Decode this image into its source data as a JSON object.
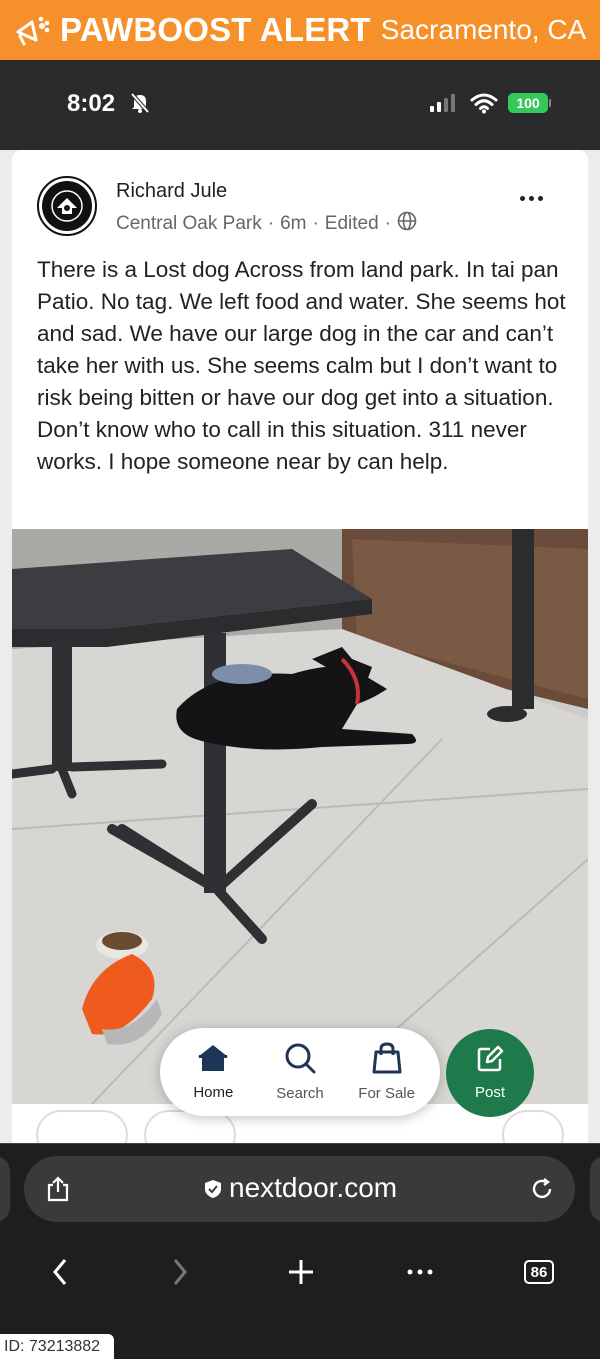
{
  "banner": {
    "brand": "PAWBOOST ALERT",
    "city": "Sacramento, CA",
    "color": "#f5902a"
  },
  "status": {
    "time": "8:02",
    "battery": "100"
  },
  "post": {
    "author": "Richard Jule",
    "location": "Central Oak Park",
    "age": "6m",
    "edited": "Edited",
    "sep": "·",
    "text": "There is a Lost dog Across from land park. In tai pan Patio. No tag. We left food and water. She seems hot and sad. We have our large dog in the car and can’t take her with us. She seems calm but I don’t want to risk being bitten or have our dog get into a situation. Don’t know who to call in this situation. 311 never works. I hope someone near by can help."
  },
  "nav": {
    "items": [
      {
        "label": "Home",
        "icon": "home-icon"
      },
      {
        "label": "Search",
        "icon": "search-icon"
      },
      {
        "label": "For Sale",
        "icon": "shopping-bag-icon"
      }
    ],
    "post_label": "Post",
    "post_color": "#1f7a4b"
  },
  "browser": {
    "url": "nextdoor.com",
    "tab_count": "86"
  },
  "id_label": "ID: 73213882"
}
